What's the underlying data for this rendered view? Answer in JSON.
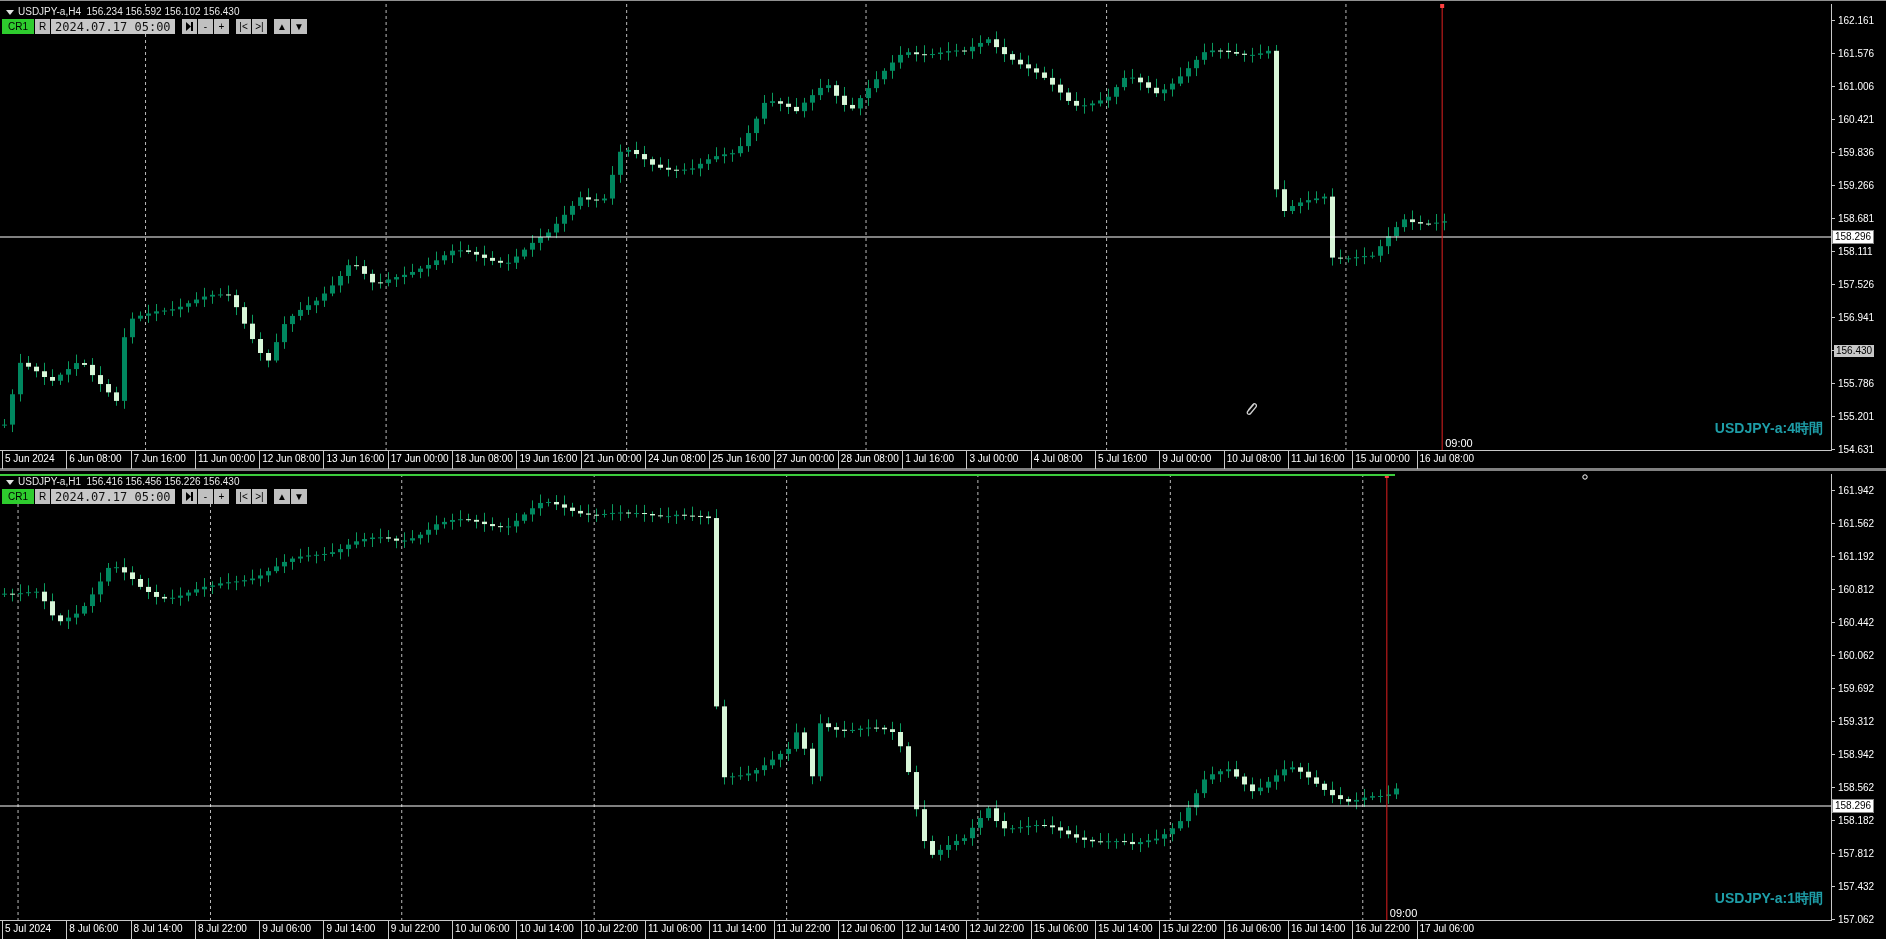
{
  "panes": [
    {
      "kind": "h4",
      "header": "USDJPY-a,H4  156.234 156.592 156.102 156.430",
      "toolbar": [
        [
          {
            "kind": "cr",
            "label": "CR1"
          },
          {
            "kind": "plain",
            "label": "R"
          },
          {
            "kind": "field",
            "value": "2024.07.17 05:00"
          }
        ],
        [
          {
            "kind": "step"
          },
          {
            "kind": "plain",
            "label": "-"
          },
          {
            "kind": "plain",
            "label": "+"
          }
        ],
        [
          {
            "kind": "plain",
            "label": "|<"
          },
          {
            "kind": "plain",
            "label": ">|"
          }
        ],
        [
          {
            "kind": "plain",
            "label": "▲"
          },
          {
            "kind": "plain",
            "label": "▼"
          }
        ]
      ],
      "price_axis": [
        {
          "kind": "tick",
          "label": "162.161"
        },
        {
          "kind": "tick",
          "label": "161.576"
        },
        {
          "kind": "tick",
          "label": "161.006"
        },
        {
          "kind": "tick",
          "label": "160.421"
        },
        {
          "kind": "tick",
          "label": "159.836"
        },
        {
          "kind": "tick",
          "label": "159.266"
        },
        {
          "kind": "tick",
          "label": "158.681"
        },
        {
          "kind": "tick",
          "label": "158.111"
        },
        {
          "kind": "tick",
          "label": "157.526"
        },
        {
          "kind": "tick",
          "label": "156.941"
        },
        {
          "kind": "current",
          "label": "156.430"
        },
        {
          "kind": "tick",
          "label": "155.786"
        },
        {
          "kind": "tick",
          "label": "155.201"
        },
        {
          "kind": "tick",
          "label": "154.631"
        }
      ],
      "price_line": "158.296",
      "time_marker": "09:00",
      "caption": "USDJPY-a:4時間",
      "time_axis": [
        "5 Jun 2024",
        "6 Jun 08:00",
        "7 Jun 16:00",
        "11 Jun 00:00",
        "12 Jun 08:00",
        "13 Jun 16:00",
        "17 Jun 00:00",
        "18 Jun 08:00",
        "19 Jun 16:00",
        "21 Jun 00:00",
        "24 Jun 08:00",
        "25 Jun 16:00",
        "27 Jun 00:00",
        "28 Jun 08:00",
        "1 Jul 16:00",
        "3 Jul 00:00",
        "4 Jul 08:00",
        "5 Jul 16:00",
        "9 Jul 00:00",
        "10 Jul 08:00",
        "11 Jul 16:00",
        "15 Jul 00:00",
        "16 Jul 08:00"
      ]
    },
    {
      "kind": "h1",
      "header": "USDJPY-a,H1  156.416 156.456 156.226 156.430",
      "toolbar": [
        [
          {
            "kind": "cr",
            "label": "CR1"
          },
          {
            "kind": "plain",
            "label": "R"
          },
          {
            "kind": "field",
            "value": "2024.07.17 05:00"
          }
        ],
        [
          {
            "kind": "step"
          },
          {
            "kind": "plain",
            "label": "-"
          },
          {
            "kind": "plain",
            "label": "+"
          }
        ],
        [
          {
            "kind": "plain",
            "label": "|<"
          },
          {
            "kind": "plain",
            "label": ">|"
          }
        ],
        [
          {
            "kind": "plain",
            "label": "▲"
          },
          {
            "kind": "plain",
            "label": "▼"
          }
        ]
      ],
      "price_axis": [
        {
          "kind": "tick",
          "label": "161.942"
        },
        {
          "kind": "tick",
          "label": "161.562"
        },
        {
          "kind": "tick",
          "label": "161.192"
        },
        {
          "kind": "tick",
          "label": "160.812"
        },
        {
          "kind": "tick",
          "label": "160.442"
        },
        {
          "kind": "tick",
          "label": "160.062"
        },
        {
          "kind": "tick",
          "label": "159.692"
        },
        {
          "kind": "tick",
          "label": "159.312"
        },
        {
          "kind": "tick",
          "label": "158.942"
        },
        {
          "kind": "tick",
          "label": "158.562"
        },
        {
          "kind": "tick",
          "label": "158.182"
        },
        {
          "kind": "tick",
          "label": "157.812"
        },
        {
          "kind": "tick",
          "label": "157.432"
        },
        {
          "kind": "tick",
          "label": "157.062"
        }
      ],
      "price_line": "158.296",
      "time_marker": "09:00",
      "caption": "USDJPY-a:1時間",
      "time_axis": [
        "5 Jul 2024",
        "8 Jul 06:00",
        "8 Jul 14:00",
        "8 Jul 22:00",
        "9 Jul 06:00",
        "9 Jul 14:00",
        "9 Jul 22:00",
        "10 Jul 06:00",
        "10 Jul 14:00",
        "10 Jul 22:00",
        "11 Jul 06:00",
        "11 Jul 14:00",
        "11 Jul 22:00",
        "12 Jul 06:00",
        "12 Jul 14:00",
        "12 Jul 22:00",
        "15 Jul 06:00",
        "15 Jul 14:00",
        "15 Jul 22:00",
        "16 Jul 06:00",
        "16 Jul 14:00",
        "16 Jul 22:00",
        "17 Jul 06:00"
      ]
    }
  ]
}
